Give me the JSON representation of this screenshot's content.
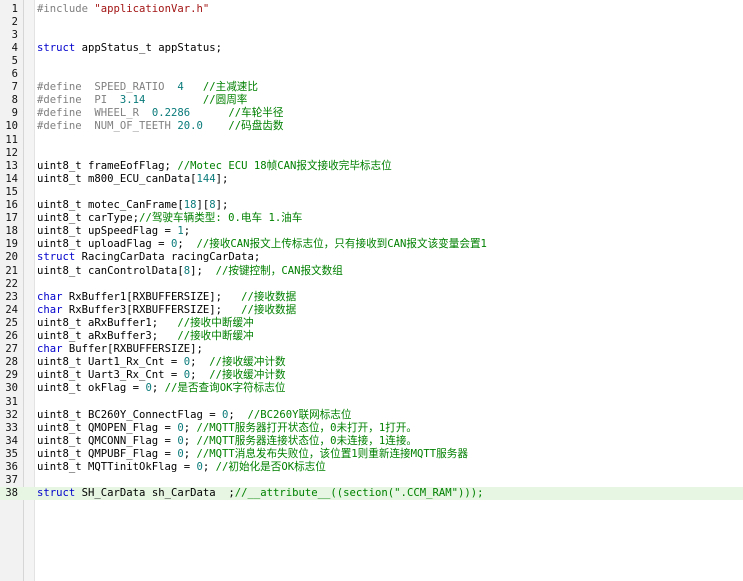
{
  "editor": {
    "current_line": 38,
    "colors": {
      "background": "#ffffff",
      "gutter": "#f2f2f2",
      "current_line": "#e6f6e2",
      "keyword": "#0000cc",
      "preprocessor": "#808080",
      "string": "#a31515",
      "comment": "#008000",
      "number": "#0a7a7a"
    },
    "lines": [
      {
        "n": "1",
        "parts": [
          {
            "t": "#include ",
            "c": "pp"
          },
          {
            "t": "\"applicationVar.h\"",
            "c": "str"
          }
        ]
      },
      {
        "n": "2",
        "parts": []
      },
      {
        "n": "3",
        "parts": []
      },
      {
        "n": "4",
        "parts": [
          {
            "t": "struct",
            "c": "kw"
          },
          {
            "t": " appStatus_t appStatus;",
            "c": ""
          }
        ]
      },
      {
        "n": "5",
        "parts": []
      },
      {
        "n": "6",
        "parts": []
      },
      {
        "n": "7",
        "parts": [
          {
            "t": "#define  SPEED_RATIO  ",
            "c": "pp"
          },
          {
            "t": "4",
            "c": "num"
          },
          {
            "t": "   //主减速比",
            "c": "com"
          }
        ]
      },
      {
        "n": "8",
        "parts": [
          {
            "t": "#define  PI  ",
            "c": "pp"
          },
          {
            "t": "3.14",
            "c": "num"
          },
          {
            "t": "         //圆周率",
            "c": "com"
          }
        ]
      },
      {
        "n": "9",
        "parts": [
          {
            "t": "#define  WHEEL_R  ",
            "c": "pp"
          },
          {
            "t": "0.2286",
            "c": "num"
          },
          {
            "t": "      //车轮半径",
            "c": "com"
          }
        ]
      },
      {
        "n": "10",
        "parts": [
          {
            "t": "#define  NUM_OF_TEETH ",
            "c": "pp"
          },
          {
            "t": "20.0",
            "c": "num"
          },
          {
            "t": "    //码盘齿数",
            "c": "com"
          }
        ]
      },
      {
        "n": "11",
        "parts": []
      },
      {
        "n": "12",
        "parts": []
      },
      {
        "n": "13",
        "parts": [
          {
            "t": "uint8_t frameEofFlag; ",
            "c": ""
          },
          {
            "t": "//Motec ECU 18帧CAN报文接收完毕标志位",
            "c": "com"
          }
        ]
      },
      {
        "n": "14",
        "parts": [
          {
            "t": "uint8_t m800_ECU_canData[",
            "c": ""
          },
          {
            "t": "144",
            "c": "num"
          },
          {
            "t": "];",
            "c": ""
          }
        ]
      },
      {
        "n": "15",
        "parts": []
      },
      {
        "n": "16",
        "parts": [
          {
            "t": "uint8_t motec_CanFrame[",
            "c": ""
          },
          {
            "t": "18",
            "c": "num"
          },
          {
            "t": "][",
            "c": ""
          },
          {
            "t": "8",
            "c": "num"
          },
          {
            "t": "];",
            "c": ""
          }
        ]
      },
      {
        "n": "17",
        "parts": [
          {
            "t": "uint8_t carType;",
            "c": ""
          },
          {
            "t": "//驾驶车辆类型: 0.电车 1.油车",
            "c": "com"
          }
        ]
      },
      {
        "n": "18",
        "parts": [
          {
            "t": "uint8_t upSpeedFlag = ",
            "c": ""
          },
          {
            "t": "1",
            "c": "num"
          },
          {
            "t": ";",
            "c": ""
          }
        ]
      },
      {
        "n": "19",
        "parts": [
          {
            "t": "uint8_t uploadFlag = ",
            "c": ""
          },
          {
            "t": "0",
            "c": "num"
          },
          {
            "t": ";  ",
            "c": ""
          },
          {
            "t": "//接收CAN报文上传标志位，只有接收到CAN报文该变量会置1",
            "c": "com"
          }
        ]
      },
      {
        "n": "20",
        "parts": [
          {
            "t": "struct",
            "c": "kw"
          },
          {
            "t": " RacingCarData racingCarData;",
            "c": ""
          }
        ]
      },
      {
        "n": "21",
        "parts": [
          {
            "t": "uint8_t canControlData[",
            "c": ""
          },
          {
            "t": "8",
            "c": "num"
          },
          {
            "t": "];  ",
            "c": ""
          },
          {
            "t": "//按键控制，CAN报文数组",
            "c": "com"
          }
        ]
      },
      {
        "n": "22",
        "parts": []
      },
      {
        "n": "23",
        "parts": [
          {
            "t": "char",
            "c": "kw"
          },
          {
            "t": " RxBuffer1[RXBUFFERSIZE];   ",
            "c": ""
          },
          {
            "t": "//接收数据",
            "c": "com"
          }
        ]
      },
      {
        "n": "24",
        "parts": [
          {
            "t": "char",
            "c": "kw"
          },
          {
            "t": " RxBuffer3[RXBUFFERSIZE];   ",
            "c": ""
          },
          {
            "t": "//接收数据",
            "c": "com"
          }
        ]
      },
      {
        "n": "25",
        "parts": [
          {
            "t": "uint8_t aRxBuffer1;   ",
            "c": ""
          },
          {
            "t": "//接收中断缓冲",
            "c": "com"
          }
        ]
      },
      {
        "n": "26",
        "parts": [
          {
            "t": "uint8_t aRxBuffer3;   ",
            "c": ""
          },
          {
            "t": "//接收中断缓冲",
            "c": "com"
          }
        ]
      },
      {
        "n": "27",
        "parts": [
          {
            "t": "char",
            "c": "kw"
          },
          {
            "t": " Buffer[RXBUFFERSIZE];",
            "c": ""
          }
        ]
      },
      {
        "n": "28",
        "parts": [
          {
            "t": "uint8_t Uart1_Rx_Cnt = ",
            "c": ""
          },
          {
            "t": "0",
            "c": "num"
          },
          {
            "t": ";  ",
            "c": ""
          },
          {
            "t": "//接收缓冲计数",
            "c": "com"
          }
        ]
      },
      {
        "n": "29",
        "parts": [
          {
            "t": "uint8_t Uart3_Rx_Cnt = ",
            "c": ""
          },
          {
            "t": "0",
            "c": "num"
          },
          {
            "t": ";  ",
            "c": ""
          },
          {
            "t": "//接收缓冲计数",
            "c": "com"
          }
        ]
      },
      {
        "n": "30",
        "parts": [
          {
            "t": "uint8_t okFlag = ",
            "c": ""
          },
          {
            "t": "0",
            "c": "num"
          },
          {
            "t": "; ",
            "c": ""
          },
          {
            "t": "//是否查询OK字符标志位",
            "c": "com"
          }
        ]
      },
      {
        "n": "31",
        "parts": []
      },
      {
        "n": "32",
        "parts": [
          {
            "t": "uint8_t BC260Y_ConnectFlag = ",
            "c": ""
          },
          {
            "t": "0",
            "c": "num"
          },
          {
            "t": ";  ",
            "c": ""
          },
          {
            "t": "//BC260Y联网标志位",
            "c": "com"
          }
        ]
      },
      {
        "n": "33",
        "parts": [
          {
            "t": "uint8_t QMOPEN_Flag = ",
            "c": ""
          },
          {
            "t": "0",
            "c": "num"
          },
          {
            "t": "; ",
            "c": ""
          },
          {
            "t": "//MQTT服务器打开状态位，0未打开，1打开。",
            "c": "com"
          }
        ]
      },
      {
        "n": "34",
        "parts": [
          {
            "t": "uint8_t QMCONN_Flag = ",
            "c": ""
          },
          {
            "t": "0",
            "c": "num"
          },
          {
            "t": "; ",
            "c": ""
          },
          {
            "t": "//MQTT服务器连接状态位，0未连接，1连接。",
            "c": "com"
          }
        ]
      },
      {
        "n": "35",
        "parts": [
          {
            "t": "uint8_t QMPUBF_Flag = ",
            "c": ""
          },
          {
            "t": "0",
            "c": "num"
          },
          {
            "t": "; ",
            "c": ""
          },
          {
            "t": "//MQTT消息发布失败位，该位置1则重新连接MQTT服务器",
            "c": "com"
          }
        ]
      },
      {
        "n": "36",
        "parts": [
          {
            "t": "uint8_t MQTTinitOkFlag = ",
            "c": ""
          },
          {
            "t": "0",
            "c": "num"
          },
          {
            "t": "; ",
            "c": ""
          },
          {
            "t": "//初始化是否OK标志位",
            "c": "com"
          }
        ]
      },
      {
        "n": "37",
        "parts": []
      },
      {
        "n": "38",
        "parts": [
          {
            "t": "struct",
            "c": "kw"
          },
          {
            "t": " SH_CarData sh_CarData  ;",
            "c": ""
          },
          {
            "t": "//__attribute__((section(\".CCM_RAM\")));",
            "c": "com"
          }
        ]
      }
    ]
  }
}
